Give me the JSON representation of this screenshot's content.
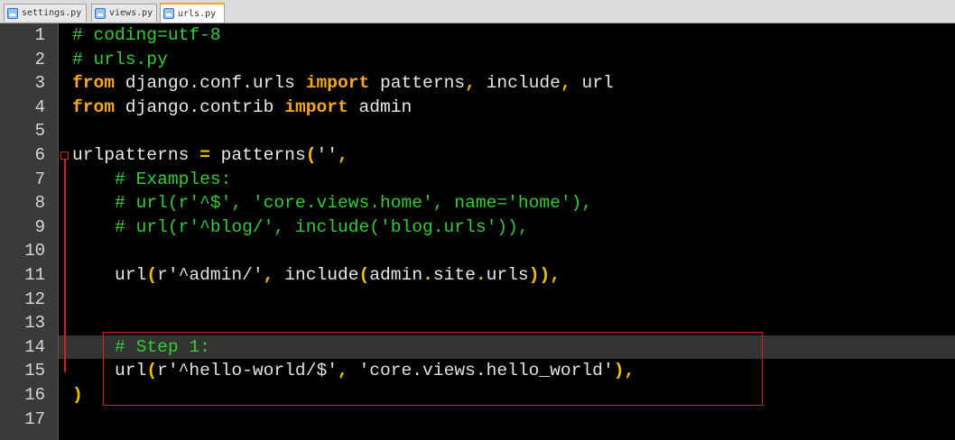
{
  "tabs": [
    {
      "label": "settings.py",
      "active": false
    },
    {
      "label": "views.py",
      "active": false
    },
    {
      "label": "urls.py",
      "active": true
    }
  ],
  "gutter": {
    "line_numbers": [
      "1",
      "2",
      "3",
      "4",
      "5",
      "6",
      "7",
      "8",
      "9",
      "10",
      "11",
      "12",
      "13",
      "14",
      "15",
      "16",
      "17"
    ]
  },
  "editor": {
    "current_line": 14,
    "lines": [
      [
        {
          "t": "# coding=utf-8",
          "c": "cm"
        }
      ],
      [
        {
          "t": "# urls.py",
          "c": "cm"
        }
      ],
      [
        {
          "t": "from",
          "c": "kw"
        },
        {
          "t": " django.conf.urls ",
          "c": ""
        },
        {
          "t": "import",
          "c": "kw"
        },
        {
          "t": " patterns",
          "c": ""
        },
        {
          "t": ",",
          "c": "pn"
        },
        {
          "t": " include",
          "c": ""
        },
        {
          "t": ",",
          "c": "pn"
        },
        {
          "t": " url",
          "c": ""
        }
      ],
      [
        {
          "t": "from",
          "c": "kw"
        },
        {
          "t": " django.contrib ",
          "c": ""
        },
        {
          "t": "import",
          "c": "kw"
        },
        {
          "t": " admin",
          "c": ""
        }
      ],
      [],
      [
        {
          "t": "urlpatterns ",
          "c": ""
        },
        {
          "t": "=",
          "c": "pn"
        },
        {
          "t": " patterns",
          "c": ""
        },
        {
          "t": "(",
          "c": "pn"
        },
        {
          "t": "''",
          "c": "st"
        },
        {
          "t": ",",
          "c": "pn"
        }
      ],
      [
        {
          "t": "    ",
          "c": ""
        },
        {
          "t": "# Examples:",
          "c": "cm"
        }
      ],
      [
        {
          "t": "    ",
          "c": ""
        },
        {
          "t": "# url(r'^$', 'core.views.home', name='home'),",
          "c": "cm"
        }
      ],
      [
        {
          "t": "    ",
          "c": ""
        },
        {
          "t": "# url(r'^blog/', include('blog.urls')),",
          "c": "cm"
        }
      ],
      [],
      [
        {
          "t": "    url",
          "c": ""
        },
        {
          "t": "(",
          "c": "pn"
        },
        {
          "t": "r'^admin/'",
          "c": "st"
        },
        {
          "t": ",",
          "c": "pn"
        },
        {
          "t": " include",
          "c": ""
        },
        {
          "t": "(",
          "c": "pn"
        },
        {
          "t": "admin",
          "c": ""
        },
        {
          "t": ".",
          "c": "pn"
        },
        {
          "t": "site",
          "c": ""
        },
        {
          "t": ".",
          "c": "pn"
        },
        {
          "t": "urls",
          "c": ""
        },
        {
          "t": "))",
          "c": "pn"
        },
        {
          "t": ",",
          "c": "pn"
        }
      ],
      [],
      [],
      [
        {
          "t": "    ",
          "c": ""
        },
        {
          "t": "# Step 1:",
          "c": "cm"
        }
      ],
      [
        {
          "t": "    url",
          "c": ""
        },
        {
          "t": "(",
          "c": "pn"
        },
        {
          "t": "r'^hello-world/$'",
          "c": "st"
        },
        {
          "t": ",",
          "c": "pn"
        },
        {
          "t": " ",
          "c": ""
        },
        {
          "t": "'core.views.hello_world'",
          "c": "st"
        },
        {
          "t": ")",
          "c": "pn"
        },
        {
          "t": ",",
          "c": "pn"
        }
      ],
      [
        {
          "t": ")",
          "c": "pn"
        }
      ],
      []
    ]
  },
  "colors": {
    "background": "#000000",
    "comment": "#33cc33",
    "keyword": "#f5a623",
    "punctuation": "#f0c000",
    "annotation_box": "#d82020"
  },
  "icons": {
    "tab_file": "file-icon",
    "fold": "fold-minus-icon"
  }
}
